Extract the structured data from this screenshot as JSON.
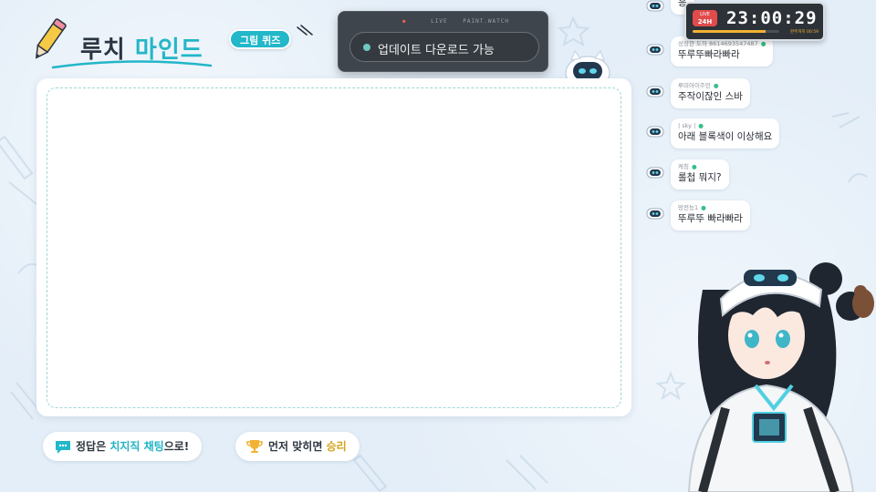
{
  "header": {
    "title_main": "루치",
    "title_accent": "마인드",
    "badge": "그림 퀴즈"
  },
  "update_popup": {
    "meta_left": "LIVE",
    "meta_right": "PAINT.WATCH",
    "message": "업데이트 다운로드 가능"
  },
  "timer": {
    "live_top": "LIVE",
    "live_bottom": "24H",
    "time": "23:00:29",
    "progress": 0.84,
    "footer": "완주까지 00:59"
  },
  "chat": [
    {
      "user": "",
      "message": "응"
    },
    {
      "user": "성장한 도하 8614693547487",
      "message": "뚜루뚜빠라빠라"
    },
    {
      "user": "루미아이주민",
      "message": "주작이잖인 스바"
    },
    {
      "user": "| sky |",
      "message": "아래 블록색이 이상해요"
    },
    {
      "user": "케칭",
      "message": "롤첩 뭐지?"
    },
    {
      "user": "망전능1",
      "message": "뚜루뚜 빠라빠라"
    }
  ],
  "bottom": {
    "hint1_prefix": "정답은 ",
    "hint1_accent": "치지직 채팅",
    "hint1_suffix": "으로!",
    "hint2_prefix": "먼저 맞히면 ",
    "hint2_accent": "승리"
  },
  "colors": {
    "accent": "#23b6c8",
    "background": "#e4eef8",
    "gold": "#d7a21a",
    "panel_dark": "#3f454c"
  }
}
